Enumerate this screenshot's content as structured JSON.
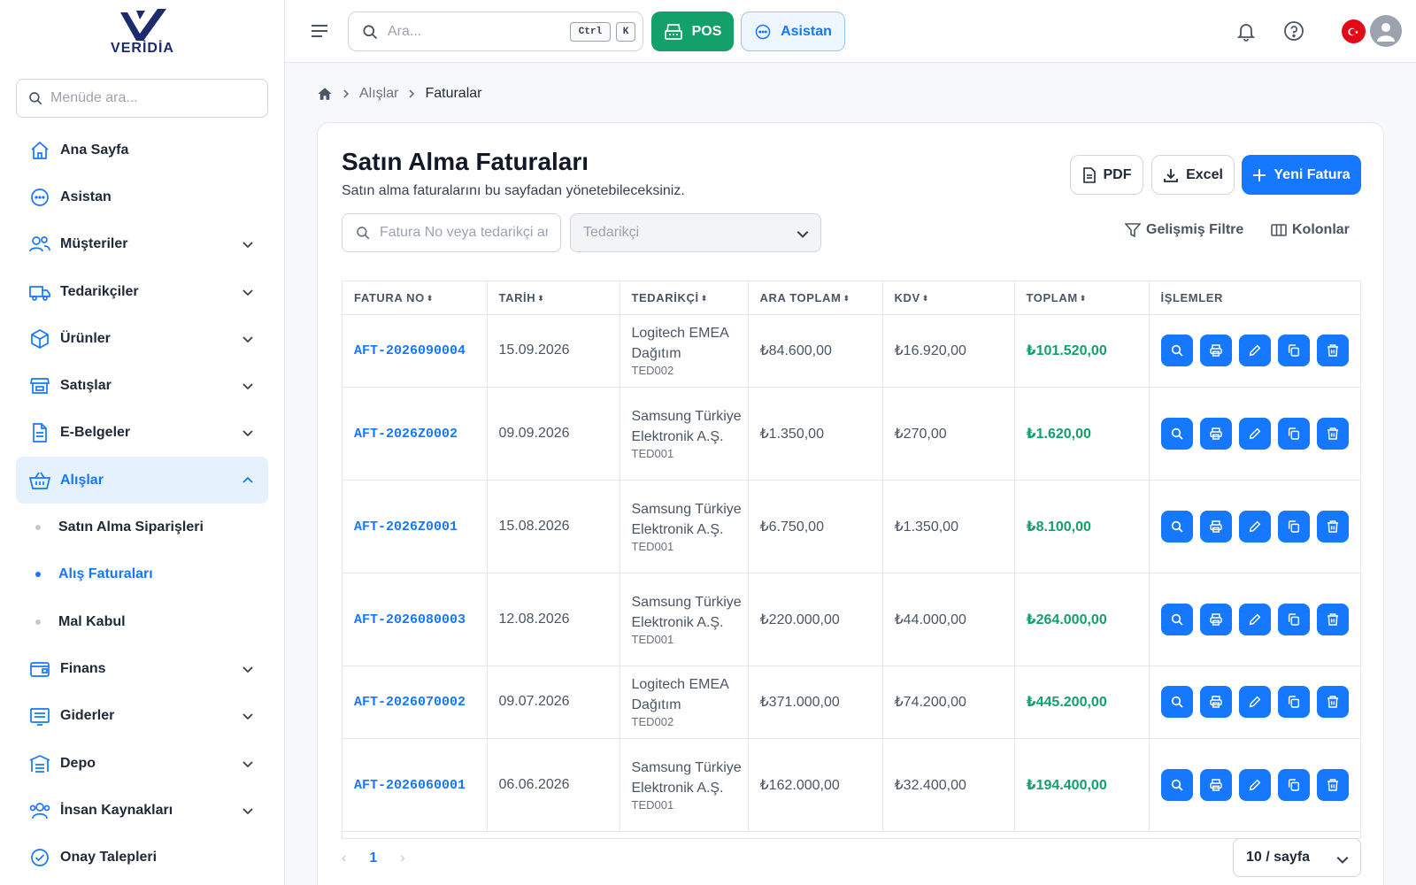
{
  "brand": {
    "logo_text": "VERİDİA"
  },
  "sidebar": {
    "search_placeholder": "Menüde ara...",
    "items": [
      {
        "label": "Ana Sayfa",
        "icon": "home-icon"
      },
      {
        "label": "Asistan",
        "icon": "chat-icon"
      },
      {
        "label": "Müşteriler",
        "icon": "users-icon"
      },
      {
        "label": "Tedarikçiler",
        "icon": "truck-icon"
      },
      {
        "label": "Ürünler",
        "icon": "box-icon"
      },
      {
        "label": "Satışlar",
        "icon": "store-icon"
      },
      {
        "label": "E-Belgeler",
        "icon": "document-icon"
      },
      {
        "label": "Alışlar",
        "icon": "basket-icon",
        "active": true
      },
      {
        "label": "Finans",
        "icon": "wallet-icon"
      },
      {
        "label": "Giderler",
        "icon": "receipt-icon"
      },
      {
        "label": "Depo",
        "icon": "warehouse-icon"
      },
      {
        "label": "İnsan Kaynakları",
        "icon": "people-icon"
      },
      {
        "label": "Onay Talepleri",
        "icon": "check-circle-icon"
      }
    ],
    "subitems": [
      {
        "label": "Satın Alma Siparişleri"
      },
      {
        "label": "Alış Faturaları",
        "active": true
      },
      {
        "label": "Mal Kabul"
      }
    ]
  },
  "header": {
    "search_placeholder": "Ara...",
    "kbd_ctrl": "Ctrl",
    "kbd_k": "K",
    "pos_label": "POS",
    "assistant_label": "Asistan"
  },
  "breadcrumb": {
    "parent": "Alışlar",
    "current": "Faturalar"
  },
  "page": {
    "title": "Satın Alma Faturaları",
    "subtitle": "Satın alma faturalarını bu sayfadan yönetebileceksiniz.",
    "pdf_label": "PDF",
    "excel_label": "Excel",
    "new_label": "Yeni Fatura",
    "search_placeholder": "Fatura No veya tedarikçi ara",
    "supplier_placeholder": "Tedarikçi",
    "advanced_filter_label": "Gelişmiş Filtre",
    "columns_label": "Kolonlar"
  },
  "table": {
    "headers": {
      "invoice_no": "FATURA NO",
      "date": "TARİH",
      "supplier": "TEDARİKÇİ",
      "subtotal": "ARA TOPLAM",
      "vat": "KDV",
      "total": "TOPLAM",
      "actions": "İŞLEMLER"
    },
    "rows": [
      {
        "invoice_no": "AFT-2026090004",
        "date": "15.09.2026",
        "supplier": "Logitech EMEA Dağıtım",
        "code": "TED002",
        "subtotal": "₺84.600,00",
        "vat": "₺16.920,00",
        "total": "₺101.520,00"
      },
      {
        "invoice_no": "AFT-2026Z0002",
        "date": "09.09.2026",
        "supplier": "Samsung Türkiye Elektronik A.Ş.",
        "code": "TED001",
        "subtotal": "₺1.350,00",
        "vat": "₺270,00",
        "total": "₺1.620,00"
      },
      {
        "invoice_no": "AFT-2026Z0001",
        "date": "15.08.2026",
        "supplier": "Samsung Türkiye Elektronik A.Ş.",
        "code": "TED001",
        "subtotal": "₺6.750,00",
        "vat": "₺1.350,00",
        "total": "₺8.100,00"
      },
      {
        "invoice_no": "AFT-2026080003",
        "date": "12.08.2026",
        "supplier": "Samsung Türkiye Elektronik A.Ş.",
        "code": "TED001",
        "subtotal": "₺220.000,00",
        "vat": "₺44.000,00",
        "total": "₺264.000,00"
      },
      {
        "invoice_no": "AFT-2026070002",
        "date": "09.07.2026",
        "supplier": "Logitech EMEA Dağıtım",
        "code": "TED002",
        "subtotal": "₺371.000,00",
        "vat": "₺74.200,00",
        "total": "₺445.200,00"
      },
      {
        "invoice_no": "AFT-2026060001",
        "date": "06.06.2026",
        "supplier": "Samsung Türkiye Elektronik A.Ş.",
        "code": "TED001",
        "subtotal": "₺162.000,00",
        "vat": "₺32.400,00",
        "total": "₺194.400,00"
      }
    ],
    "action_icons": [
      "search-icon",
      "printer-icon",
      "pencil-icon",
      "copy-icon",
      "trash-icon"
    ]
  },
  "pagination": {
    "current_page": "1",
    "page_size_label": "10 / sayfa"
  },
  "colors": {
    "primary": "#1677ff",
    "success": "#14a06b",
    "active_bg": "#e6f1fe"
  }
}
